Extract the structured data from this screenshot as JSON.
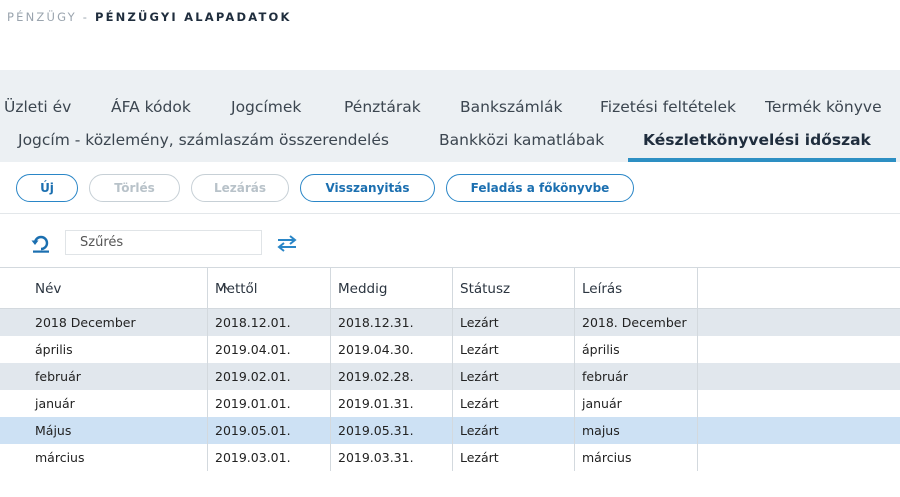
{
  "breadcrumb": {
    "parent": "PÉNZÜGY -",
    "current": "PÉNZÜGYI ALAPADATOK"
  },
  "tabs": {
    "row1": [
      "Üzleti év",
      "ÁFA kódok",
      "Jogcímek",
      "Pénztárak",
      "Bankszámlák",
      "Fizetési feltételek",
      "Termék könyve"
    ],
    "row2": [
      "Jogcím - közlemény, számlaszám összerendelés",
      "Bankközi kamatlábak",
      "Készletkönyvelési időszak"
    ],
    "active": "Készletkönyvelési időszak"
  },
  "toolbar": {
    "new": "Új",
    "delete": "Törlés",
    "close": "Lezárás",
    "revert": "Visszanyitás",
    "post": "Feladás a főkönyvbe"
  },
  "filter": {
    "placeholder": "Szűrés",
    "reset_icon": "undo-icon",
    "swap_icon": "swap-arrows-icon"
  },
  "table": {
    "columns": [
      "Név",
      "Mettől",
      "Meddig",
      "Státusz",
      "Leírás"
    ],
    "sort_column": "Név",
    "sort_direction": "ascending",
    "rows": [
      [
        "2018 December",
        "2018.12.01.",
        "2018.12.31.",
        "Lezárt",
        "2018. December"
      ],
      [
        "április",
        "2019.04.01.",
        "2019.04.30.",
        "Lezárt",
        "április"
      ],
      [
        "február",
        "2019.02.01.",
        "2019.02.28.",
        "Lezárt",
        "február"
      ],
      [
        "január",
        "2019.01.01.",
        "2019.01.31.",
        "Lezárt",
        "január"
      ],
      [
        "Május",
        "2019.05.01.",
        "2019.05.31.",
        "Lezárt",
        "majus"
      ],
      [
        "március",
        "2019.03.01.",
        "2019.03.31.",
        "Lezárt",
        "március"
      ]
    ],
    "selected_row": 4
  },
  "colors": {
    "accent": "#2a86c7",
    "tab_underline": "#2d8fc3",
    "stripe": "#e1e7ed",
    "selected": "#cde1f4",
    "tab_bar": "#ecf0f3"
  }
}
